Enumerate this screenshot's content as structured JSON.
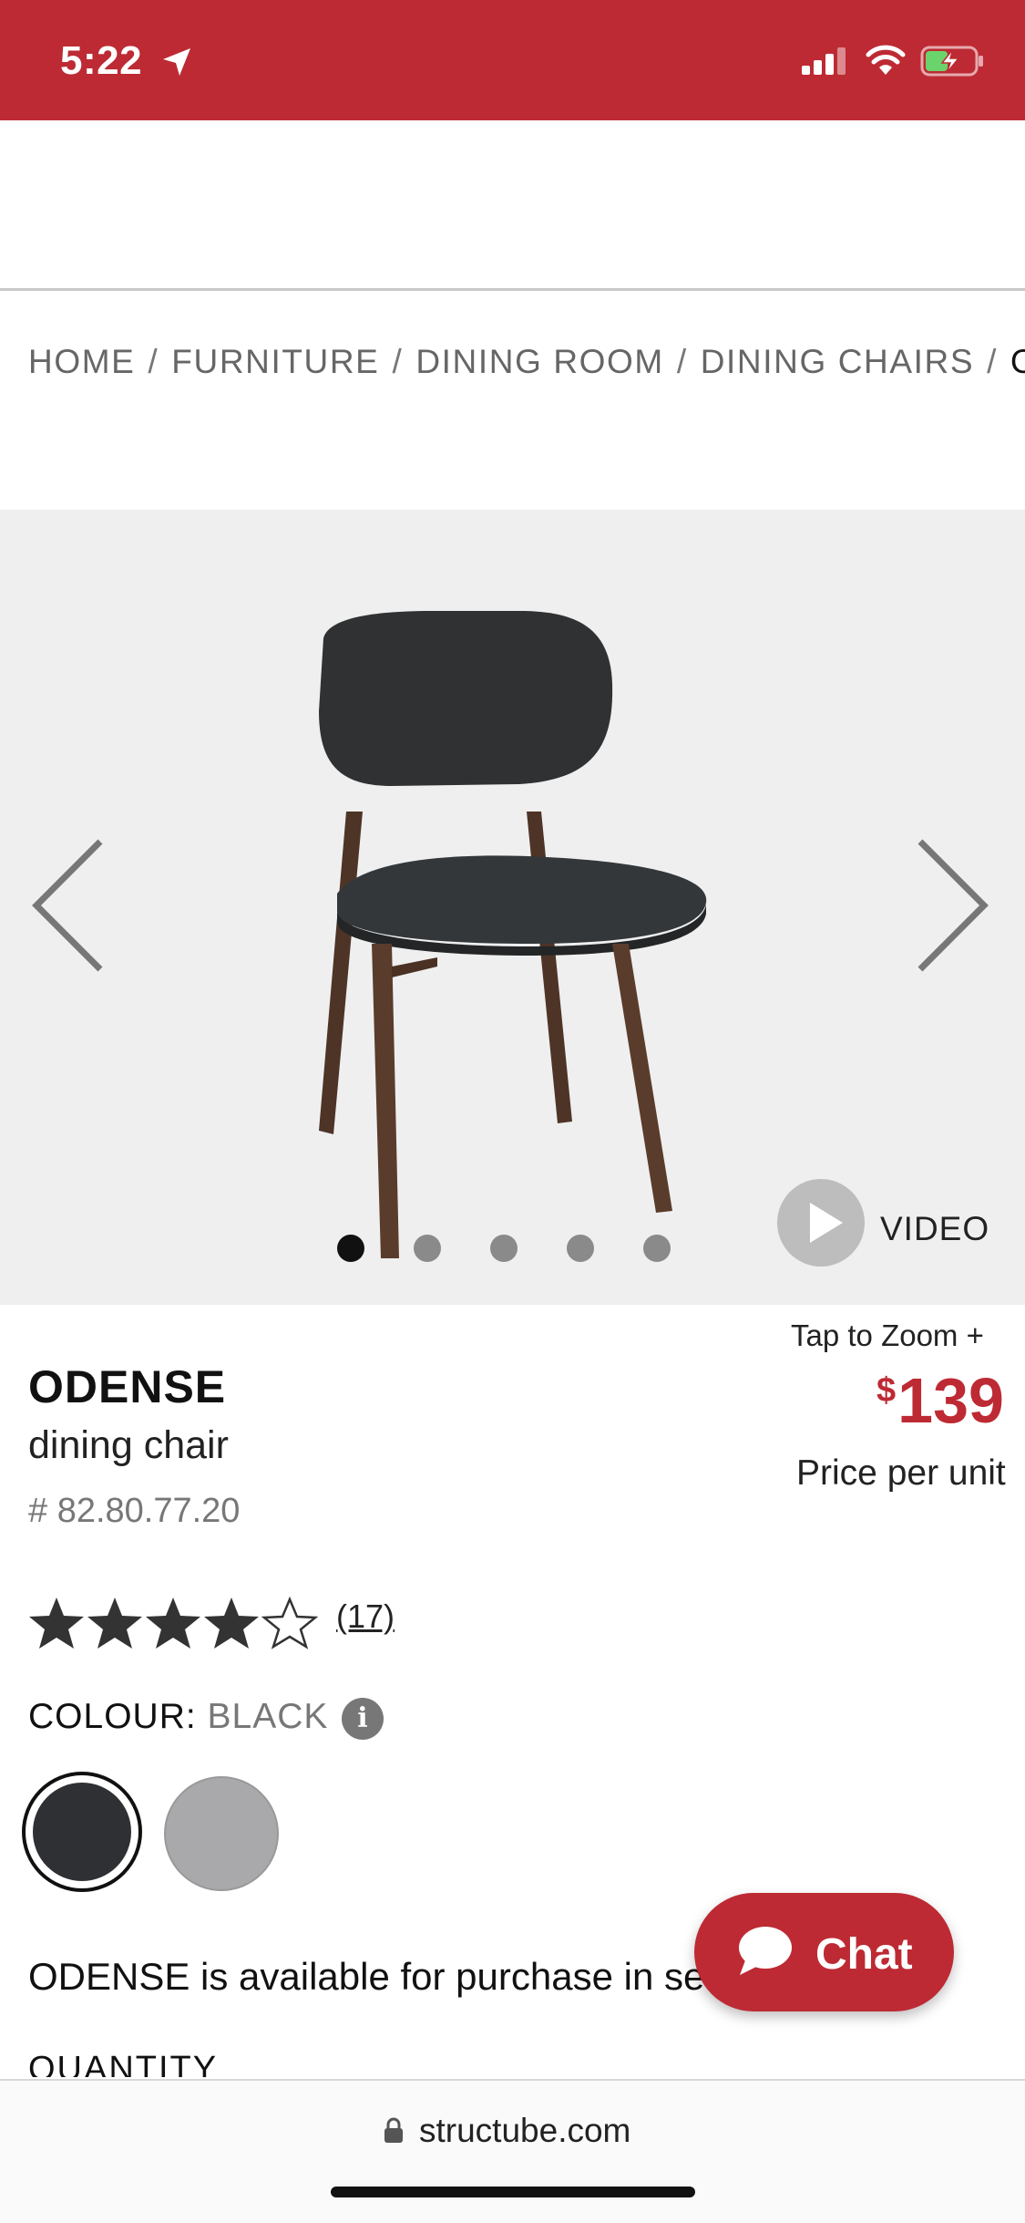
{
  "status_bar": {
    "time": "5:22"
  },
  "breadcrumb": {
    "items": [
      "HOME",
      "FURNITURE",
      "DINING ROOM",
      "DINING CHAIRS"
    ],
    "separator": "/",
    "current": "O"
  },
  "gallery": {
    "video_label": "VIDEO",
    "slides_total": 5,
    "active_slide": 1
  },
  "product": {
    "name": "ODENSE",
    "subtitle": "dining chair",
    "sku": "# 82.80.77.20",
    "tap_to_zoom": "Tap to Zoom +",
    "price_currency": "$",
    "price_value": "139",
    "price_note": "Price per unit",
    "rating": 4,
    "rating_max": 5,
    "review_count": "(17)",
    "colour_label": "COLOUR:",
    "colour_value": "BLACK",
    "info_glyph": "i",
    "swatches": [
      {
        "name": "black",
        "color": "#2e3033",
        "selected": true
      },
      {
        "name": "grey",
        "color": "#a9a9ab",
        "selected": false
      }
    ],
    "availability_text": "ODENSE is available for purchase in set",
    "quantity_label": "QUANTITY"
  },
  "chat": {
    "label": "Chat"
  },
  "browser": {
    "url": "structube.com"
  },
  "colors": {
    "brand_red": "#bd2a33"
  }
}
